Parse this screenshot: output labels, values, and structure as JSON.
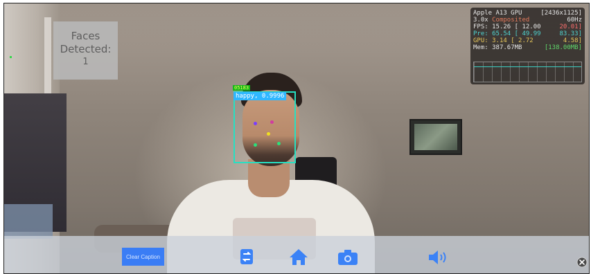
{
  "faces_panel": {
    "label": "Faces Detected:",
    "count": "1"
  },
  "detection": {
    "top_tag": "05183",
    "label": "happy, 0.9996",
    "box_color": "#26e0c3",
    "label_color": "#2fb7ff"
  },
  "perf_hud": {
    "gpu": "Apple A13 GPU",
    "resolution": "[2436x1125]",
    "scale": "3.0x",
    "mode": "Composited",
    "refresh": "60Hz",
    "fps_label": "FPS:",
    "fps": "15.26",
    "fps_min": "[ 12.00",
    "fps_max": "20.01]",
    "pre_label": "Pre:",
    "pre": "65.54",
    "pre_min": "[ 49.99",
    "pre_max": "83.33]",
    "gpu_label": "GPU:",
    "gpu_time": "3.14",
    "gpu_min": "[ 2.72",
    "gpu_max": "4.58]",
    "mem_label": "Mem:",
    "mem": "387.67MB",
    "mem_peak": "[138.00MB]"
  },
  "toolbar": {
    "clear_caption": "Clear Caption",
    "icons": [
      "camera-switch-icon",
      "home-icon",
      "camera-icon",
      "speaker-icon",
      "close-circle-icon"
    ]
  },
  "colors": {
    "accent": "#3a7df5",
    "icon_blue": "#3b82f6",
    "toolbar_bg": "#cbd1da"
  }
}
